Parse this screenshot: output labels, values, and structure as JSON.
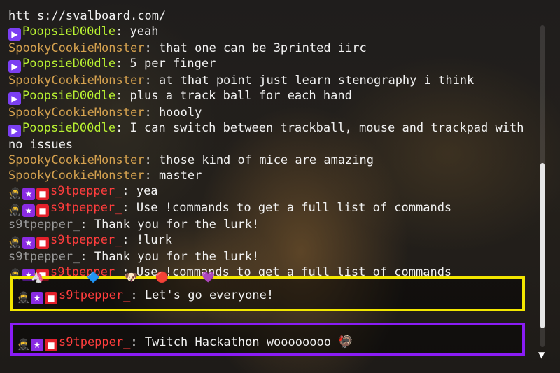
{
  "lines": [
    {
      "name": "",
      "text": "htt s://svalboard.com/"
    },
    {
      "name": "PoopsieD00dle",
      "text": ": yeah"
    },
    {
      "name": "SpookyCookieMonster",
      "text": ": that one can be 3printed iirc"
    },
    {
      "name": "PoopsieD00dle",
      "text": ": 5 per finger"
    },
    {
      "name": "SpookyCookieMonster",
      "text": ": at that point just learn stenography i think"
    },
    {
      "name": "PoopsieD00dle",
      "text": ": plus a track ball for each hand"
    },
    {
      "name": "SpookyCookieMonster",
      "text": ": hoooly"
    },
    {
      "name": "PoopsieD00dle",
      "text": ": I can switch between trackball, mouse and trackpad with no issues"
    },
    {
      "name": "SpookyCookieMonster",
      "text": ": those kind of mice are amazing"
    },
    {
      "name": "SpookyCookieMonster",
      "text": ": master"
    },
    {
      "name": "s9tpepper_",
      "text": ": yea"
    },
    {
      "name": "s9tpepper_",
      "text": ": Use !commands to get a full list of commands"
    },
    {
      "name": "s9tpepper_",
      "text": ": Thank you for the lurk!"
    },
    {
      "name": "s9tpepper_",
      "text": ": !lurk"
    },
    {
      "name": "s9tpepper_",
      "text": ": Thank you for the lurk!"
    },
    {
      "name": "s9tpepper_",
      "text": ": Use !commands to get a full list of commands"
    }
  ],
  "highlight1": {
    "name": "s9tpepper_",
    "text": ": Let's go everyone!"
  },
  "highlight2": {
    "name": "s9tpepper_",
    "text": ": Twitch Hackathon woooooooo",
    "emote": "🦃"
  },
  "emojis": {
    "e1": "🦄",
    "e2": "🔷",
    "e3": "🐶",
    "e4": "🔴",
    "e5": "💜"
  },
  "icons": {
    "sub": "▶",
    "star": "★",
    "cam": "■",
    "mask": "🥷"
  },
  "colors": {
    "highlight1_border": "#f2e600",
    "highlight2_border": "#8a1cf5",
    "name_poopsie": "#b9f232",
    "name_spooky": "#d4a14f",
    "name_pepper": "#ff3d3d"
  },
  "scrollbar": {
    "position": 0.88
  }
}
